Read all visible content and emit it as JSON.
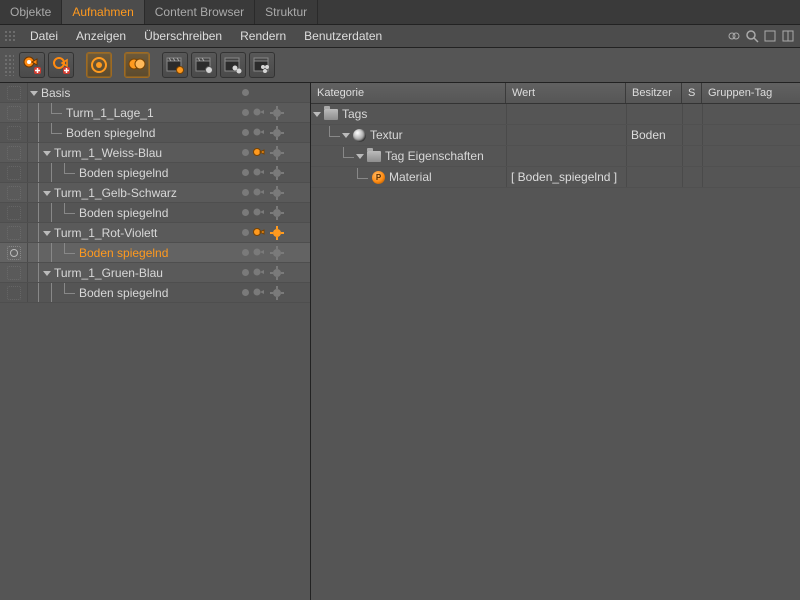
{
  "tabs": [
    {
      "label": "Objekte",
      "active": false
    },
    {
      "label": "Aufnahmen",
      "active": true
    },
    {
      "label": "Content Browser",
      "active": false
    },
    {
      "label": "Struktur",
      "active": false
    }
  ],
  "menus": {
    "items": [
      "Datei",
      "Anzeigen",
      "Überschreiben",
      "Rendern",
      "Benutzerdaten"
    ]
  },
  "columns": {
    "kategorie": "Kategorie",
    "wert": "Wert",
    "besitzer": "Besitzer",
    "s": "S",
    "gruppen": "Gruppen-Tag"
  },
  "left_tree": [
    {
      "name": "Basis",
      "depth": 0,
      "arrow": "open",
      "eye": "off",
      "dot": true,
      "actions": "none"
    },
    {
      "name": "Turm_1_Lage_1",
      "depth": 1,
      "arrow": null,
      "eye": "off",
      "dot": true,
      "actions": "pair"
    },
    {
      "name": "Boden spiegelnd",
      "depth": 1,
      "arrow": null,
      "eye": "off",
      "dot": true,
      "actions": "pair"
    },
    {
      "name": "Turm_1_Weiss-Blau",
      "depth": 1,
      "arrow": "open",
      "eye": "off",
      "dot": true,
      "actions": "orange-pair"
    },
    {
      "name": "Boden spiegelnd",
      "depth": 2,
      "arrow": null,
      "eye": "off",
      "dot": true,
      "actions": "pair"
    },
    {
      "name": "Turm_1_Gelb-Schwarz",
      "depth": 1,
      "arrow": "open",
      "eye": "off",
      "dot": true,
      "actions": "pair"
    },
    {
      "name": "Boden spiegelnd",
      "depth": 2,
      "arrow": null,
      "eye": "off",
      "dot": true,
      "actions": "pair"
    },
    {
      "name": "Turm_1_Rot-Violett",
      "depth": 1,
      "arrow": "open",
      "eye": "off",
      "dot": true,
      "actions": "orange-pair-star"
    },
    {
      "name": "Boden spiegelnd",
      "depth": 2,
      "arrow": null,
      "eye": "on",
      "dot": true,
      "actions": "pair",
      "highlight": true,
      "active": true
    },
    {
      "name": "Turm_1_Gruen-Blau",
      "depth": 1,
      "arrow": "open",
      "eye": "off",
      "dot": true,
      "actions": "pair"
    },
    {
      "name": "Boden spiegelnd",
      "depth": 2,
      "arrow": null,
      "eye": "off",
      "dot": true,
      "actions": "pair"
    }
  ],
  "right_tree": [
    {
      "label": "Tags",
      "depth": 0,
      "arrow": "open",
      "icon": "folder",
      "wert": "",
      "besitzer": ""
    },
    {
      "label": "Textur",
      "depth": 1,
      "arrow": "open",
      "icon": "sphere",
      "wert": "",
      "besitzer": "Boden"
    },
    {
      "label": "Tag Eigenschaften",
      "depth": 2,
      "arrow": "open",
      "icon": "folder",
      "wert": "",
      "besitzer": ""
    },
    {
      "label": "Material",
      "depth": 3,
      "arrow": null,
      "icon": "material",
      "wert": "[ Boden_spiegelnd ]",
      "besitzer": ""
    }
  ]
}
